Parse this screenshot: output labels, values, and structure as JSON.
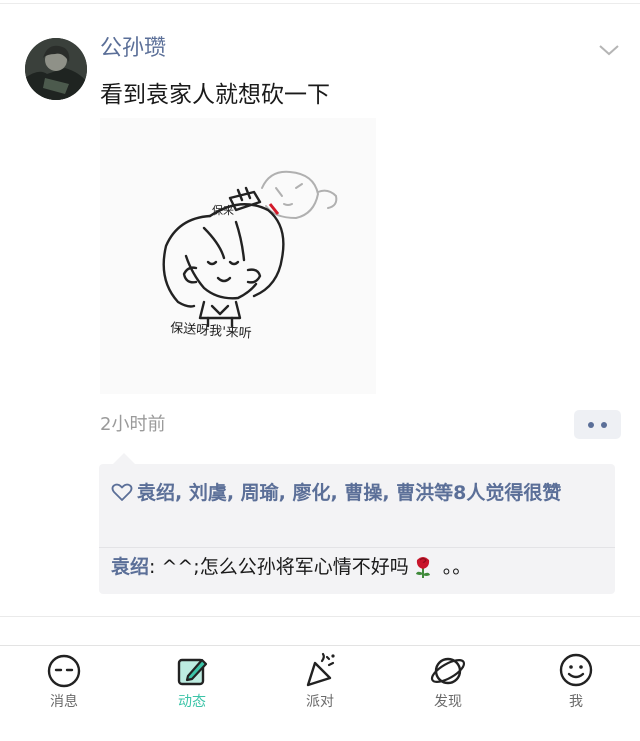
{
  "post": {
    "author": "公孙瓒",
    "text": "看到袁家人就想砍一下",
    "image_caption_left": "保送呀我'来听",
    "image_caption_right": "保来",
    "time": "2小时前"
  },
  "likes": {
    "names": "袁绍, 刘虞, 周瑜, 廖化, 曹操, 曹洪等8人觉得很赞"
  },
  "comment": {
    "author": "袁绍",
    "sep": ": ",
    "text": "^^;怎么公孙将军心情不好吗",
    "tail": " 。。"
  },
  "tabs": [
    {
      "label": "消息",
      "icon": "message-icon"
    },
    {
      "label": "动态",
      "icon": "feed-icon",
      "active": true
    },
    {
      "label": "派对",
      "icon": "party-icon"
    },
    {
      "label": "发现",
      "icon": "discover-icon"
    },
    {
      "label": "我",
      "icon": "profile-icon"
    }
  ],
  "colors": {
    "name_blue": "#5b6f98",
    "active_tab": "#3cc4a8",
    "comment_bg": "#f3f3f5"
  }
}
